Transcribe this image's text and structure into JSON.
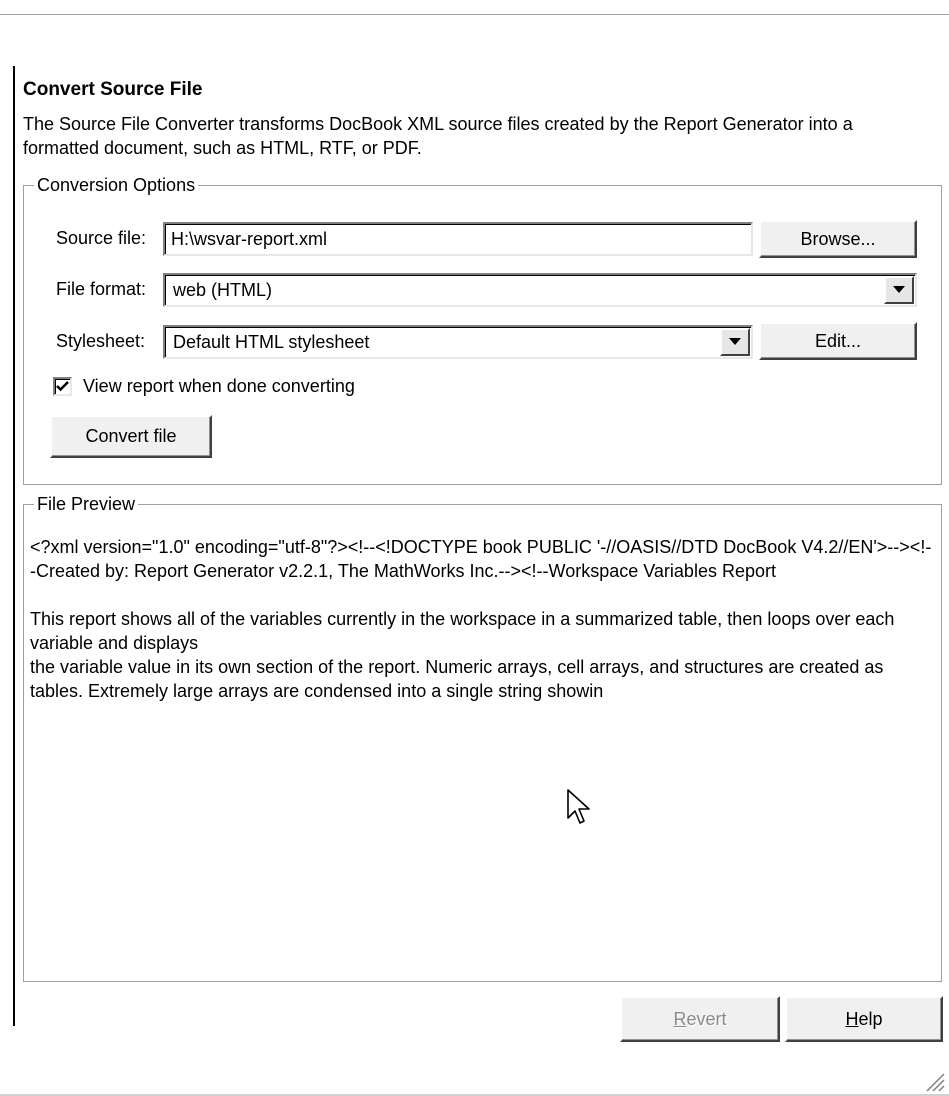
{
  "section": {
    "title": "Convert Source File",
    "description": "The Source File Converter transforms DocBook XML source files created by the Report Generator into a formatted document, such as HTML, RTF, or PDF."
  },
  "conversion_options": {
    "group_label": "Conversion Options",
    "source_file": {
      "label": "Source file:",
      "value": "H:\\wsvar-report.xml",
      "browse_label": "Browse..."
    },
    "file_format": {
      "label": "File format:",
      "selected": "web (HTML)"
    },
    "stylesheet": {
      "label": "Stylesheet:",
      "selected": "Default HTML stylesheet",
      "edit_label": "Edit..."
    },
    "view_report": {
      "label": "View report when done converting",
      "checked": true
    },
    "convert_label": "Convert file"
  },
  "file_preview": {
    "group_label": "File Preview",
    "paragraphs": [
      "<?xml version=\"1.0\" encoding=\"utf-8\"?><!--<!DOCTYPE book PUBLIC '-//OASIS//DTD DocBook V4.2//EN'>--><!--Created by: Report Generator v2.2.1, The MathWorks Inc.--><!--Workspace Variables Report",
      "This report shows all of the variables currently in the workspace in a summarized table, then loops over each variable and displays\nthe variable value in its own section of the report.  Numeric arrays, cell arrays, and structures are created as tables.  Extremely large arrays are condensed into a single string showin"
    ]
  },
  "footer": {
    "revert_label": "Revert",
    "revert_enabled": false,
    "help_label": "Help"
  },
  "icons": {
    "dropdown": "chevron-down-icon",
    "check": "checkmark-icon",
    "cursor": "mouse-pointer-icon",
    "grip": "resize-grip-icon"
  }
}
